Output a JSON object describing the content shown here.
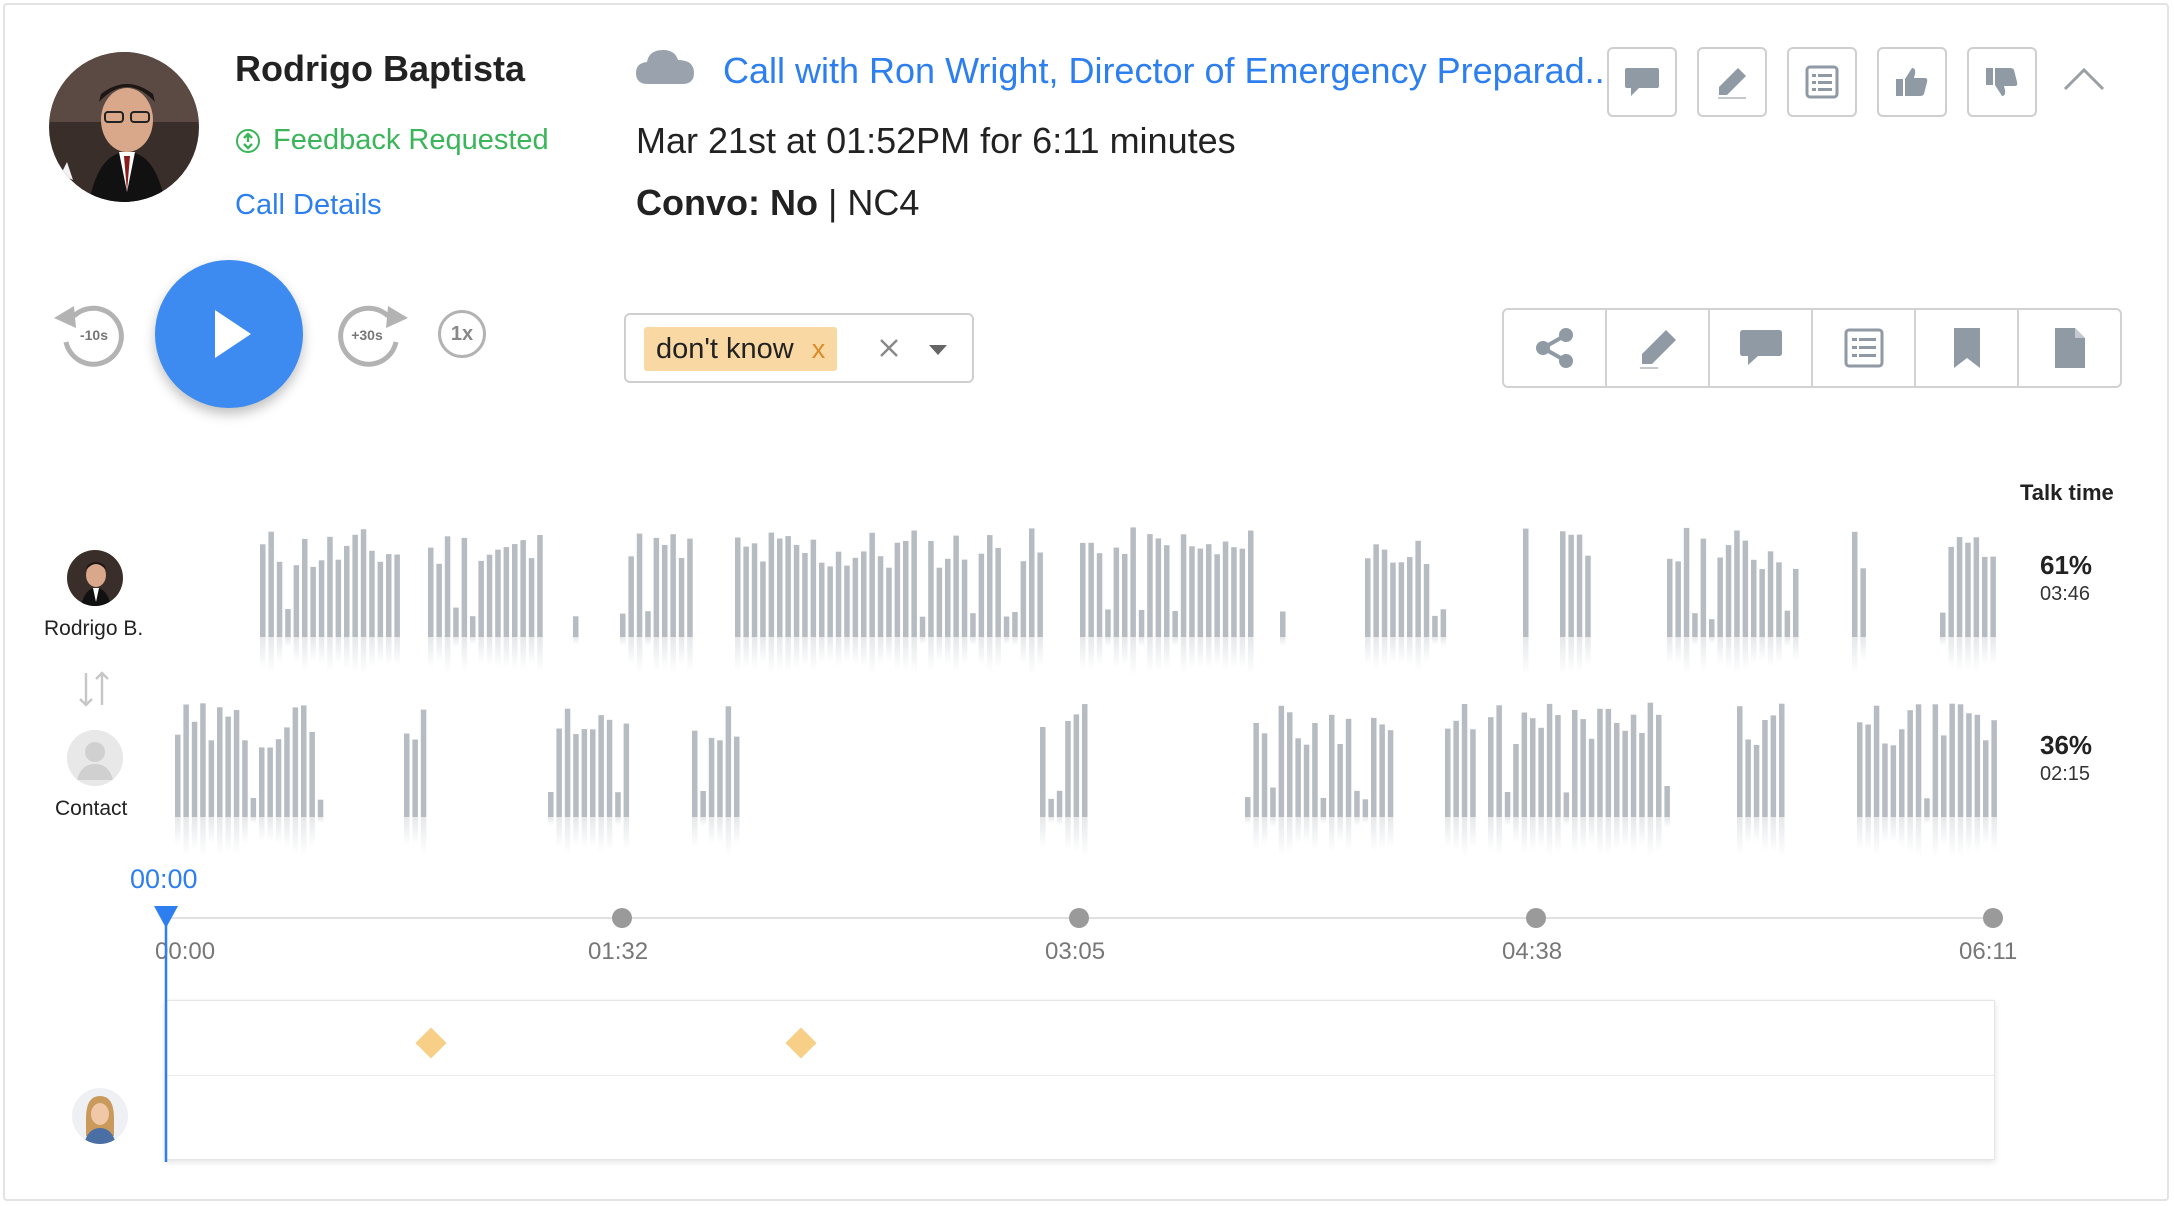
{
  "rep": {
    "name": "Rodrigo Baptista",
    "feedback_status": "Feedback Requested",
    "details_link": "Call Details",
    "short_name": "Rodrigo B."
  },
  "call": {
    "title": "Call with Ron Wright, Director of Emergency Preparad...",
    "date_line": "Mar 21st at 01:52PM for 6:11 minutes",
    "convo_label": "Convo: No",
    "convo_sep": " | ",
    "convo_extra": "NC4"
  },
  "header_toolbar": [
    "comment-icon",
    "pencil-icon",
    "list-icon",
    "thumbs-up-icon",
    "thumbs-down-icon",
    "chevron-up-icon"
  ],
  "player": {
    "rewind_label": "-10s",
    "forward_label": "+30s",
    "speed_label": "1x",
    "current_time": "00:00"
  },
  "tags": {
    "selected": "don't know",
    "remove_label": "x"
  },
  "segment_toolbar": [
    "share-icon",
    "pencil-icon",
    "comment-icon",
    "list-icon",
    "bookmark-icon",
    "document-icon"
  ],
  "talk_time": {
    "label": "Talk time",
    "rep_pct": "61%",
    "rep_time": "03:46",
    "contact_pct": "36%",
    "contact_time": "02:15"
  },
  "contact": {
    "label": "Contact"
  },
  "timeline": {
    "ticks": [
      "00:00",
      "01:32",
      "03:05",
      "04:38",
      "06:11"
    ],
    "duration_seconds": 371,
    "playhead_seconds": 0
  },
  "comment_markers_seconds": [
    54,
    129
  ],
  "colors": {
    "accent": "#2d7ff0",
    "feedback": "#3bb55a",
    "wave_bar": "#b6bcc2",
    "tag_bg": "#f9d8a3",
    "marker": "#f7cf87",
    "play_button": "#3d8bf0"
  }
}
